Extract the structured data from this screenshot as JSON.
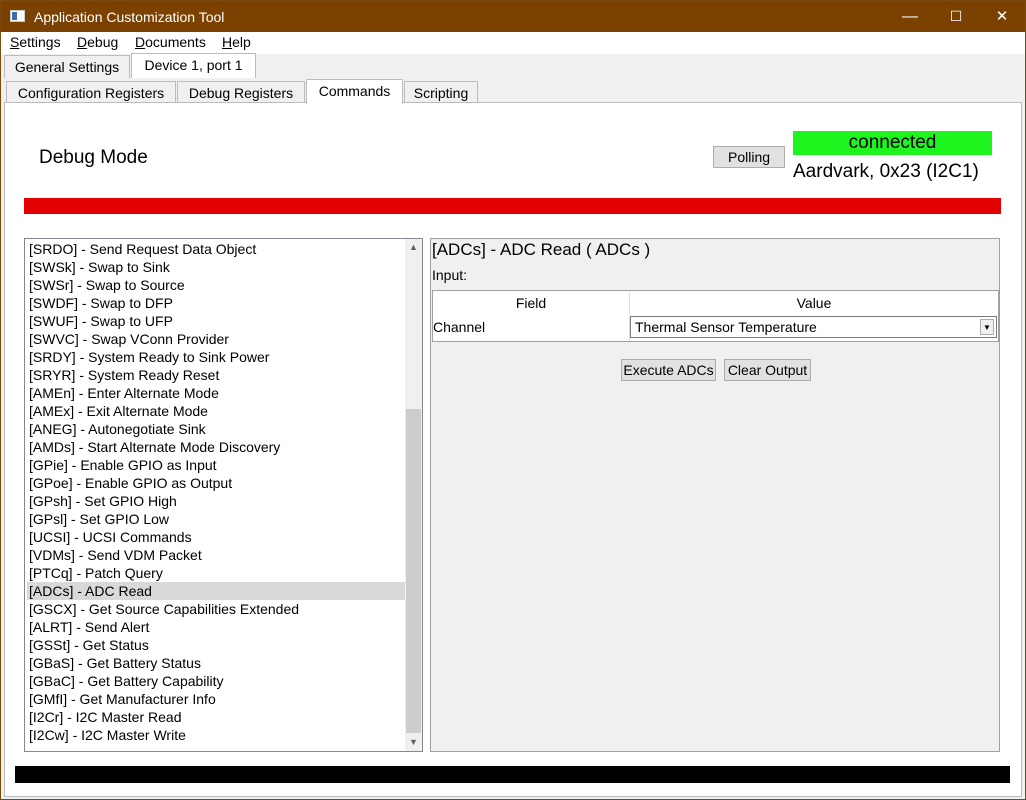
{
  "window": {
    "title": "Application Customization Tool",
    "minimize": "—",
    "maximize": "☐",
    "close": "✕"
  },
  "menu": [
    {
      "label": "Settings"
    },
    {
      "label": "Debug"
    },
    {
      "label": "Documents"
    },
    {
      "label": "Help"
    }
  ],
  "top_tabs": [
    "General Settings",
    "Device 1, port 1"
  ],
  "sub_tabs": [
    "Configuration Registers",
    "Debug Registers",
    "Commands",
    "Scripting"
  ],
  "header": {
    "mode": "Debug Mode",
    "polling_label": "Polling",
    "status": "connected",
    "device": "Aardvark, 0x23 (I2C1)"
  },
  "colors": {
    "status_ok": "#1ef41e",
    "alert_bar": "#e20000",
    "titlebar": "#7a4100"
  },
  "commands": [
    "[SRDO] - Send Request Data Object",
    "[SWSk] - Swap to Sink",
    "[SWSr] - Swap to Source",
    "[SWDF] - Swap to DFP",
    "[SWUF] - Swap to UFP",
    "[SWVC] - Swap VConn Provider",
    "[SRDY] - System Ready to Sink Power",
    "[SRYR] - System Ready Reset",
    "[AMEn] - Enter Alternate Mode",
    "[AMEx] - Exit Alternate Mode",
    "[ANEG] - Autonegotiate Sink",
    "[AMDs] - Start Alternate Mode Discovery",
    "[GPie] - Enable GPIO as Input",
    "[GPoe] - Enable GPIO as Output",
    "[GPsh] - Set GPIO High",
    "[GPsl] - Set GPIO Low",
    "[UCSI] - UCSI Commands",
    "[VDMs] - Send VDM Packet",
    "[PTCq] - Patch Query",
    "[ADCs] - ADC Read",
    "[GSCX] - Get Source Capabilities Extended",
    "[ALRT] - Send Alert",
    "[GSSt] - Get Status",
    "[GBaS] - Get Battery Status",
    "[GBaC] - Get Battery Capability",
    "[GMfI] - Get Manufacturer Info",
    "[I2Cr] - I2C Master Read",
    "[I2Cw] - I2C Master Write"
  ],
  "selected_command_index": 19,
  "detail": {
    "heading": "[ADCs] - ADC Read  ( ADCs )",
    "input_label": "Input:",
    "columns": [
      "Field",
      "Value"
    ],
    "row": {
      "field": "Channel",
      "value": "Thermal Sensor Temperature"
    },
    "execute_label": "Execute ADCs",
    "clear_label": "Clear Output"
  }
}
